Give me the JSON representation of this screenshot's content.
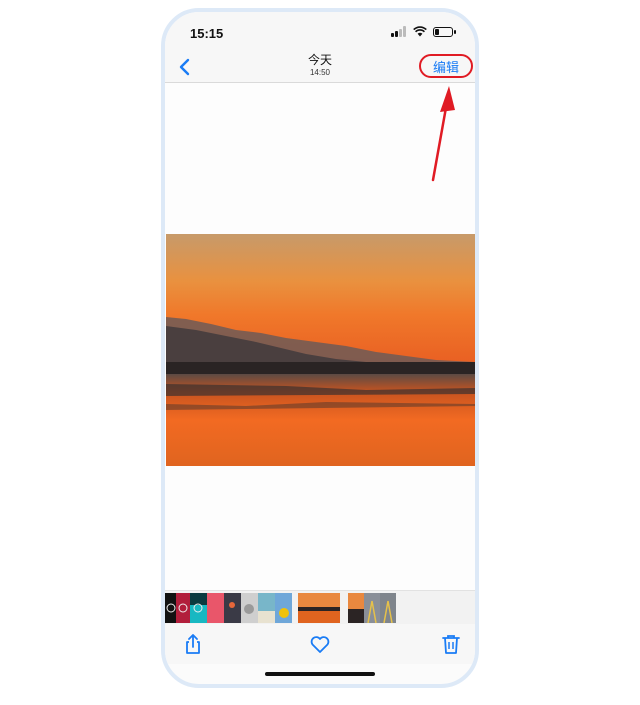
{
  "status_bar": {
    "time": "15:15",
    "signal_bars": 2,
    "battery_level": 0.25,
    "icons": [
      "signal-icon",
      "wifi-icon",
      "battery-icon"
    ]
  },
  "nav": {
    "back_icon": "chevron-left-icon",
    "title": "今天",
    "subtitle": "14:50",
    "edit_label": "编辑"
  },
  "photo": {
    "description_icon": "sunset-lake-photo"
  },
  "thumbnails": {
    "count": 10
  },
  "toolbar": {
    "icons": [
      "share-icon",
      "heart-icon",
      "trash-icon"
    ]
  },
  "colors": {
    "accent": "#1a7cf5",
    "annotation": "#e01b24",
    "frame": "#dde9f7"
  }
}
